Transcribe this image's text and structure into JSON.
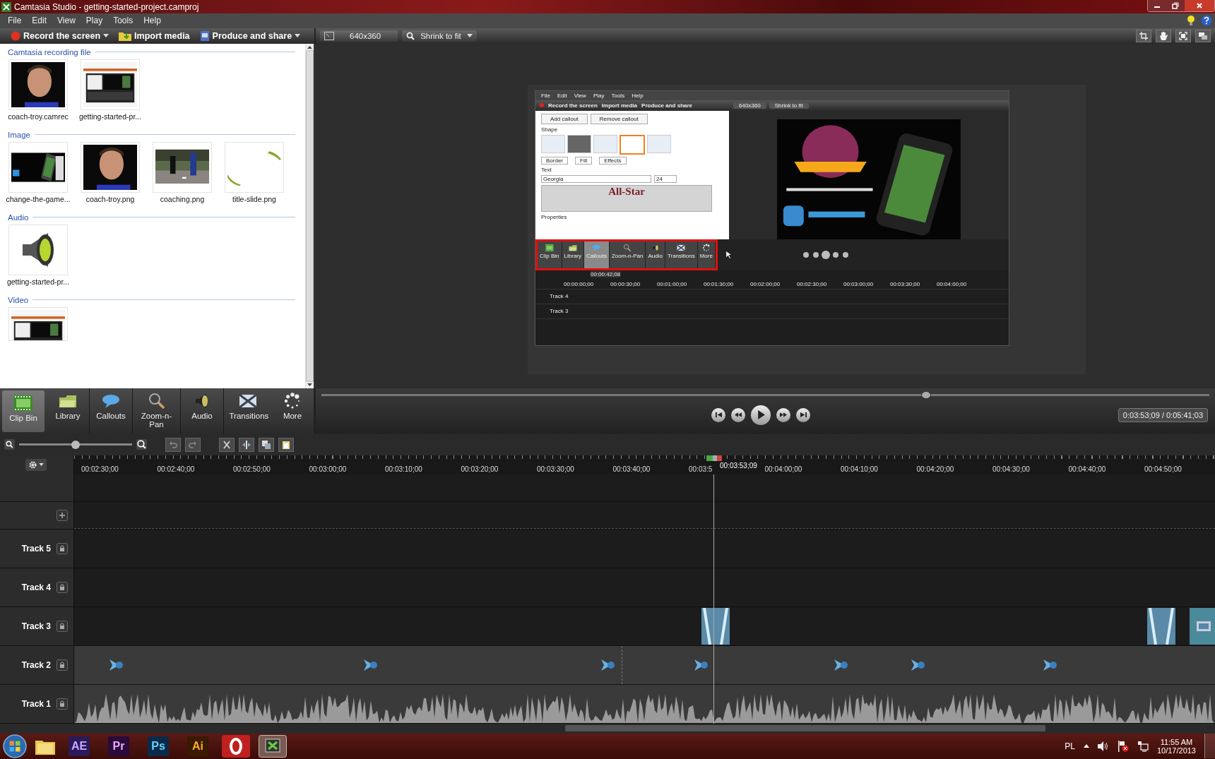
{
  "window": {
    "title": "Camtasia Studio - getting-started-project.camproj"
  },
  "menu": [
    "File",
    "Edit",
    "View",
    "Play",
    "Tools",
    "Help"
  ],
  "toolbar": [
    {
      "label": "Record the screen",
      "kind": "record",
      "dropdown": true
    },
    {
      "label": "Import media",
      "kind": "import",
      "dropdown": false
    },
    {
      "label": "Produce and share",
      "kind": "produce",
      "dropdown": true
    }
  ],
  "preview_toolbar": {
    "dimensions": "640x360",
    "zoom": "Shrink to fit"
  },
  "clip_bin": {
    "sections": [
      {
        "title": "Camtasia recording file",
        "items": [
          {
            "name": "coach-troy.camrec",
            "kind": "portrait"
          },
          {
            "name": "getting-started-pr...",
            "kind": "screenshot"
          }
        ]
      },
      {
        "title": "Image",
        "items": [
          {
            "name": "change-the-game...",
            "kind": "slide"
          },
          {
            "name": "coach-troy.png",
            "kind": "portrait"
          },
          {
            "name": "coaching.png",
            "kind": "field"
          },
          {
            "name": "title-slide.png",
            "kind": "title"
          }
        ]
      },
      {
        "title": "Audio",
        "items": [
          {
            "name": "getting-started-pr...",
            "kind": "audio"
          }
        ]
      },
      {
        "title": "Video",
        "items": [
          {
            "kind": "video"
          }
        ]
      }
    ]
  },
  "tool_tabs": [
    {
      "label": "Clip Bin",
      "kind": "clipbin",
      "selected": true
    },
    {
      "label": "Library",
      "kind": "library",
      "selected": false
    },
    {
      "label": "Callouts",
      "kind": "callouts",
      "selected": false
    },
    {
      "label": "Zoom-n-Pan",
      "kind": "zoom",
      "selected": false
    },
    {
      "label": "Audio",
      "kind": "audio",
      "selected": false
    },
    {
      "label": "Transitions",
      "kind": "transitions",
      "selected": false
    },
    {
      "label": "More",
      "kind": "more",
      "selected": false
    }
  ],
  "preview": {
    "menu": [
      "File",
      "Edit",
      "View",
      "Play",
      "Tools",
      "Help"
    ],
    "toolbar": [
      "Record the screen",
      "Import media",
      "Produce and share"
    ],
    "dimensions": "640x360",
    "zoom": "Shrink to fit",
    "callout_buttons": [
      "Add callout",
      "Remove callout"
    ],
    "shape_label": "Shape",
    "shape_options": [
      "Border",
      "Fill",
      "Effects"
    ],
    "text_label": "Text",
    "font": "Georgia",
    "font_size": "24",
    "callout_text": "All-Star",
    "properties_label": "Properties",
    "tool_tabs": [
      {
        "label": "Clip Bin",
        "kind": "clipbin",
        "selected": false
      },
      {
        "label": "Library",
        "kind": "library",
        "selected": false
      },
      {
        "label": "Callouts",
        "kind": "callouts",
        "selected": true
      },
      {
        "label": "Zoom-n-Pan",
        "kind": "zoom",
        "selected": false
      },
      {
        "label": "Audio",
        "kind": "audio",
        "selected": false
      },
      {
        "label": "Transitions",
        "kind": "transitions",
        "selected": false
      },
      {
        "label": "More",
        "kind": "more",
        "selected": false
      }
    ],
    "highlight_tabs": true,
    "ruler": [
      "00:00:00;00",
      "00:00:30;00",
      "00:01:00;00",
      "00:01:30;00",
      "00:02:00;00",
      "00:02:30;00",
      "00:03:00;00",
      "00:03:30;00",
      "00:04:00;00"
    ],
    "playhead": "00:00:42;08",
    "tracks": [
      "Track 4",
      "Track 3"
    ]
  },
  "player": {
    "level": 0.68,
    "time": "0:03:53;09 / 0:05:41;03"
  },
  "timeline": {
    "zoom": {
      "level": 0.5
    },
    "ruler": [
      "00:02:30;00",
      "00:02:40;00",
      "00:02:50;00",
      "00:03:00;00",
      "00:03:10;00",
      "00:03:20;00",
      "00:03:30;00",
      "00:03:40;00",
      "00:03:5",
      "00:04:00;00",
      "00:04:10;00",
      "00:04:20;00",
      "00:04:30;00",
      "00:04:40;00",
      "00:04:50;00"
    ],
    "playhead": "00:03:53;09",
    "tracks": [
      {
        "name": "Track 5",
        "kind": "empty"
      },
      {
        "name": "Track 4",
        "kind": "empty"
      },
      {
        "name": "Track 3",
        "kind": "transitions"
      },
      {
        "name": "Track 2",
        "kind": "callouts"
      },
      {
        "name": "Track 1",
        "kind": "audio"
      }
    ]
  },
  "taskbar": {
    "apps": [
      {
        "kind": "explorer"
      },
      {
        "kind": "ae",
        "label": "AE"
      },
      {
        "kind": "pr",
        "label": "Pr"
      },
      {
        "kind": "ps",
        "label": "Ps"
      },
      {
        "kind": "ai",
        "label": "Ai"
      },
      {
        "kind": "opera"
      },
      {
        "kind": "camtasia"
      }
    ],
    "language": "PL",
    "time": "11:55 AM",
    "date": "10/17/2013"
  }
}
